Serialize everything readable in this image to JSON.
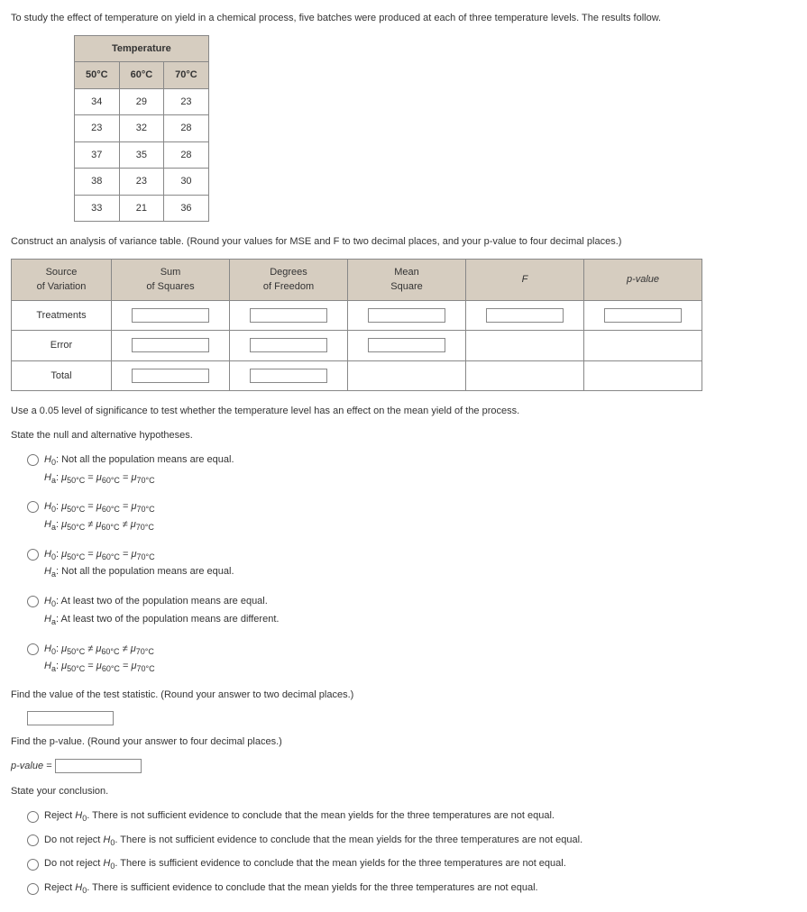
{
  "intro": "To study the effect of temperature on yield in a chemical process, five batches were produced at each of three temperature levels. The results follow.",
  "temp_table": {
    "group_header": "Temperature",
    "cols": [
      "50°C",
      "60°C",
      "70°C"
    ],
    "rows": [
      [
        "34",
        "29",
        "23"
      ],
      [
        "23",
        "32",
        "28"
      ],
      [
        "37",
        "35",
        "28"
      ],
      [
        "38",
        "23",
        "30"
      ],
      [
        "33",
        "21",
        "36"
      ]
    ]
  },
  "instruct1": "Construct an analysis of variance table. (Round your values for MSE and F to two decimal places, and your p-value to four decimal places.)",
  "anova": {
    "headers": {
      "source": "Source\nof Variation",
      "ss": "Sum\nof Squares",
      "df": "Degrees\nof Freedom",
      "ms": "Mean\nSquare",
      "f": "F",
      "p": "p-value"
    },
    "rows": {
      "treat": "Treatments",
      "error": "Error",
      "total": "Total"
    }
  },
  "instruct2": "Use a 0.05 level of significance to test whether the temperature level has an effect on the mean yield of the process.",
  "hyp_prompt": "State the null and alternative hypotheses.",
  "hyp_options": [
    {
      "h0_text": "Not all the population means are equal.",
      "ha_mu_rel": "= ="
    },
    {
      "h0_mu_rel": "= =",
      "ha_mu_rel": "≠ ≠"
    },
    {
      "h0_mu_rel": "= =",
      "ha_text": "Not all the population means are equal."
    },
    {
      "h0_text": "At least two of the population means are equal.",
      "ha_text": "At least two of the population means are different."
    },
    {
      "h0_mu_rel": "≠ ≠",
      "ha_mu_rel": "= ="
    }
  ],
  "labels": {
    "h0": "H",
    "h0_sub": "0",
    "ha": "H",
    "ha_sub": "a",
    "mu": "μ",
    "t50": "50°C",
    "t60": "60°C",
    "t70": "70°C"
  },
  "test_stat_prompt": "Find the value of the test statistic. (Round your answer to two decimal places.)",
  "pvalue_prompt": "Find the p-value. (Round your answer to four decimal places.)",
  "pvalue_label": "p-value =",
  "conclusion_prompt": "State your conclusion.",
  "conclusions": [
    "Reject H₀. There is not sufficient evidence to conclude that the mean yields for the three temperatures are not equal.",
    "Do not reject H₀. There is not sufficient evidence to conclude that the mean yields for the three temperatures are not equal.",
    "Do not reject H₀. There is sufficient evidence to conclude that the mean yields for the three temperatures are not equal.",
    "Reject H₀. There is sufficient evidence to conclude that the mean yields for the three temperatures are not equal."
  ]
}
